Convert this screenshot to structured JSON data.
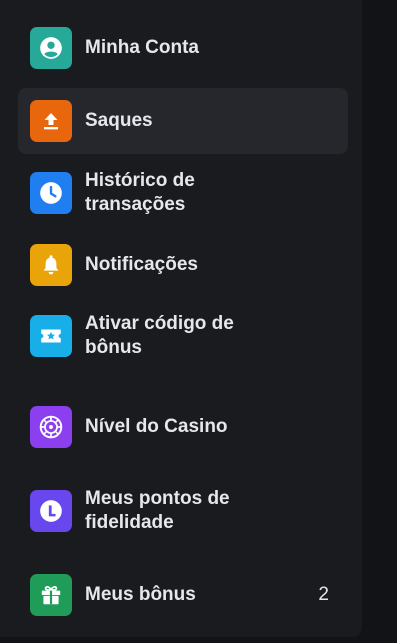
{
  "menu": {
    "items": [
      {
        "label": "Minha Conta",
        "icon": "account-icon",
        "color": "#27a99a"
      },
      {
        "label": "Saques",
        "icon": "upload-icon",
        "color": "#e8660c",
        "active": true
      },
      {
        "label": "Histórico de transações",
        "icon": "clock-icon",
        "color": "#1f7ff0"
      },
      {
        "label": "Notificações",
        "icon": "bell-icon",
        "color": "#e9a40a"
      },
      {
        "label": "Ativar código de bônus",
        "icon": "ticket-icon",
        "color": "#18aee8"
      },
      {
        "label": "Nível do Casino",
        "icon": "roulette-icon",
        "color": "#8b3fee"
      },
      {
        "label": "Meus pontos de fidelidade",
        "icon": "loyalty-icon",
        "color": "#6947ee"
      },
      {
        "label": "Meus bônus",
        "icon": "gift-icon",
        "color": "#1f9c58",
        "count": "2"
      }
    ]
  },
  "colors": {
    "background": "#121316",
    "panel": "#1a1b1f",
    "active_row": "#25272c",
    "text": "#e6e7ea"
  }
}
